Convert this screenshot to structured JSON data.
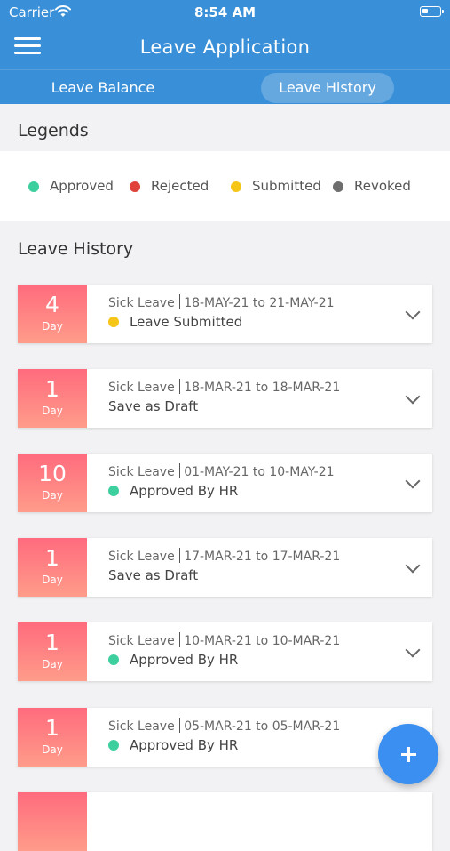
{
  "status_bar": {
    "carrier": "Carrier",
    "time": "8:54 AM"
  },
  "header": {
    "title": "Leave Application"
  },
  "tabs": [
    {
      "label": "Leave Balance",
      "selected": false
    },
    {
      "label": "Leave History",
      "selected": true
    }
  ],
  "legends": {
    "title": "Legends",
    "items": [
      {
        "label": "Approved",
        "color": "#3ecf9e"
      },
      {
        "label": "Rejected",
        "color": "#e0413a"
      },
      {
        "label": "Submitted",
        "color": "#f5c518"
      },
      {
        "label": "Revoked",
        "color": "#6e6e6e"
      }
    ]
  },
  "history": {
    "title": "Leave History",
    "day_unit": "Day",
    "entries": [
      {
        "days": "4",
        "type": "Sick Leave",
        "range": "18-MAY-21 to 21-MAY-21",
        "status": "Leave Submitted",
        "status_color": "#f5c518"
      },
      {
        "days": "1",
        "type": "Sick Leave",
        "range": "18-MAR-21 to 18-MAR-21",
        "status": "Save as Draft",
        "status_color": ""
      },
      {
        "days": "10",
        "type": "Sick Leave",
        "range": "01-MAY-21 to 10-MAY-21",
        "status": "Approved By HR",
        "status_color": "#3ecf9e"
      },
      {
        "days": "1",
        "type": "Sick Leave",
        "range": "17-MAR-21 to 17-MAR-21",
        "status": "Save as Draft",
        "status_color": ""
      },
      {
        "days": "1",
        "type": "Sick Leave",
        "range": "10-MAR-21 to 10-MAR-21",
        "status": "Approved By HR",
        "status_color": "#3ecf9e"
      },
      {
        "days": "1",
        "type": "Sick Leave",
        "range": "05-MAR-21 to 05-MAR-21",
        "status": "Approved By HR",
        "status_color": "#3ecf9e"
      }
    ]
  },
  "fab": {
    "icon": "plus-icon"
  },
  "colors": {
    "primary": "#3a90d8",
    "fab": "#3a8ff0"
  }
}
